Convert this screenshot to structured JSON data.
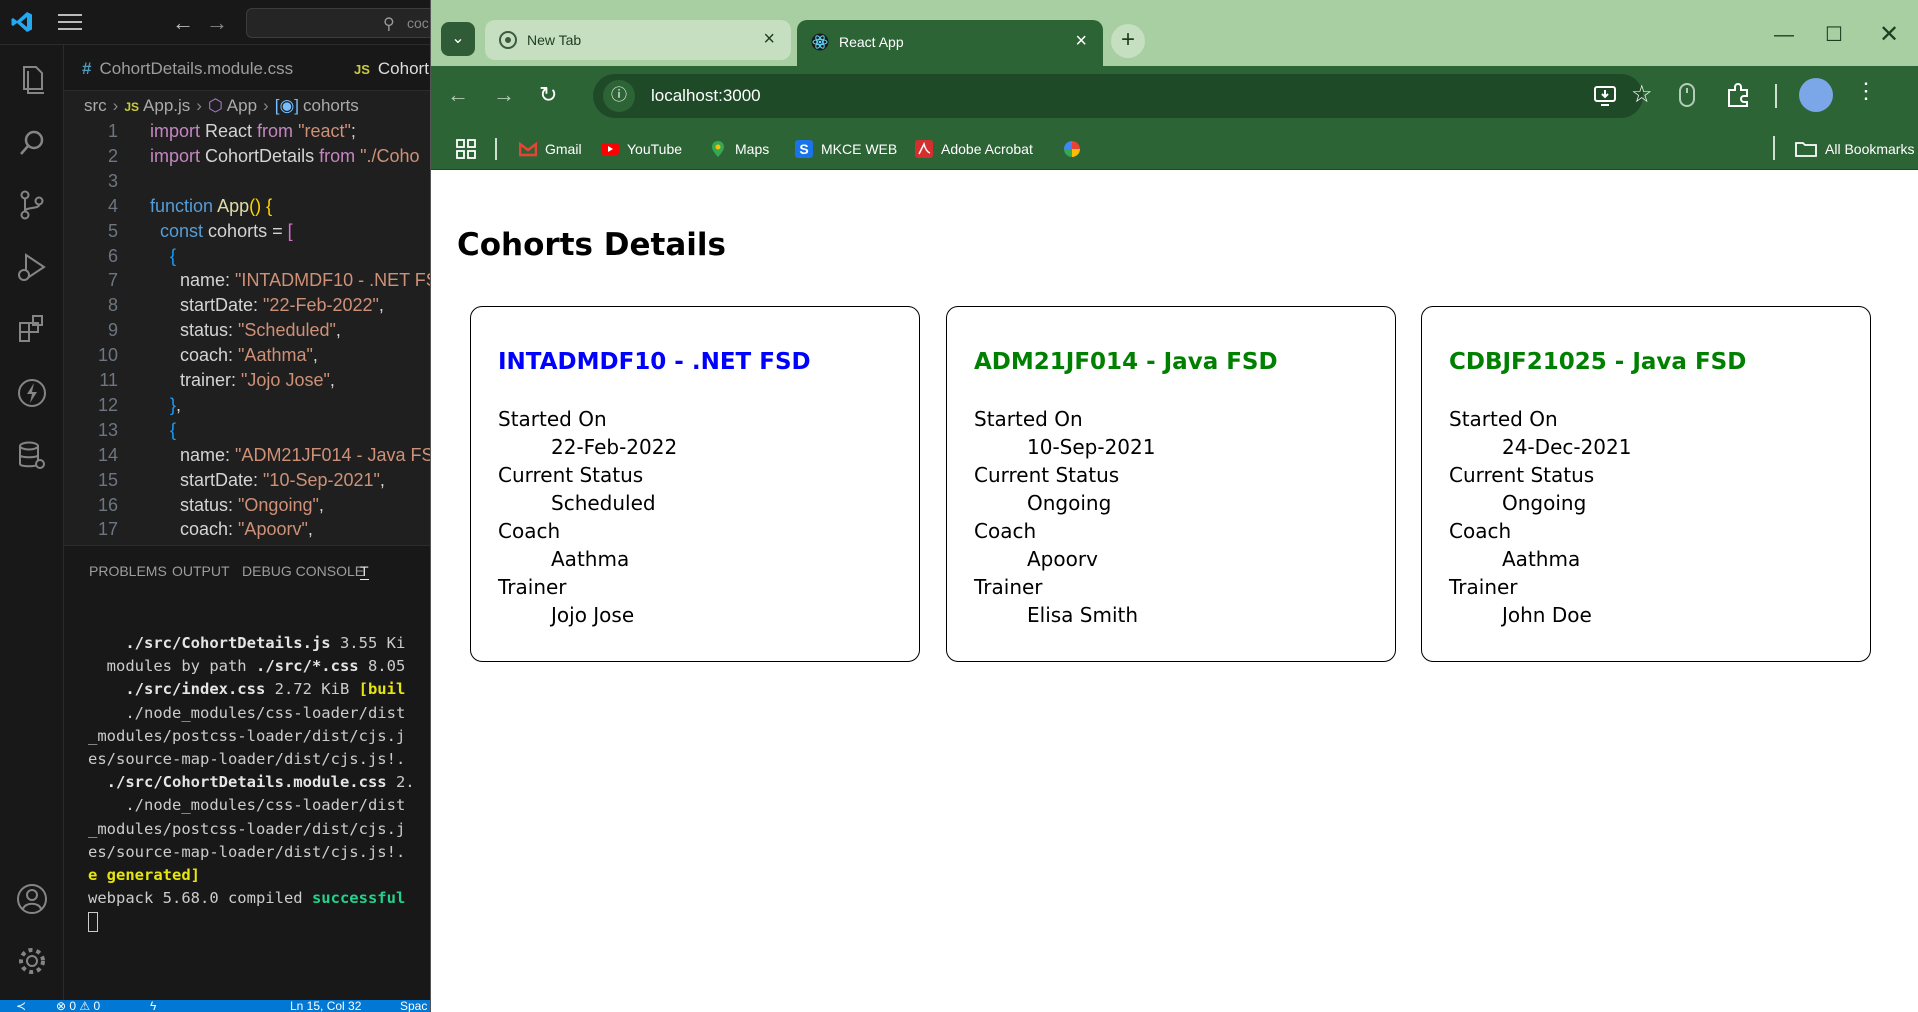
{
  "vscode": {
    "search_placeholder": "coc",
    "tabs": [
      {
        "lang": "#",
        "label": "CohortDetails.module.css"
      },
      {
        "lang": "JS",
        "label": "Cohort"
      }
    ],
    "breadcrumb": [
      "src",
      "App.js",
      "App",
      "cohorts"
    ],
    "code_lines": [
      {
        "n": "1",
        "html": "<span class=\"kw2\">import</span> React <span class=\"kw2\">from</span> <span class=\"str\">\"react\"</span>;"
      },
      {
        "n": "2",
        "html": "<span class=\"kw2\">import</span> CohortDetails <span class=\"kw2\">from</span> <span class=\"str\">\"./Coho</span>"
      },
      {
        "n": "3",
        "html": ""
      },
      {
        "n": "4",
        "html": "<span class=\"kw\">function</span> <span class=\"fn\">App</span><span class=\"br\">()</span> <span class=\"br\">{</span>"
      },
      {
        "n": "5",
        "html": "  <span class=\"kw\">const</span> cohorts = <span class=\"br2\">[</span>"
      },
      {
        "n": "6",
        "html": "    <span class=\"br3\">{</span>"
      },
      {
        "n": "7",
        "html": "      name: <span class=\"str\">\"INTADMDF10 - .NET FS</span>"
      },
      {
        "n": "8",
        "html": "      startDate: <span class=\"str\">\"22-Feb-2022\"</span>,"
      },
      {
        "n": "9",
        "html": "      status: <span class=\"str\">\"Scheduled\"</span>,"
      },
      {
        "n": "10",
        "html": "      coach: <span class=\"str\">\"Aathma\"</span>,"
      },
      {
        "n": "11",
        "html": "      trainer: <span class=\"str\">\"Jojo Jose\"</span>,"
      },
      {
        "n": "12",
        "html": "    <span class=\"br3\">}</span>,"
      },
      {
        "n": "13",
        "html": "    <span class=\"br3\">{</span>"
      },
      {
        "n": "14",
        "html": "      name: <span class=\"str\">\"ADM21JF014 - Java FSD</span>"
      },
      {
        "n": "15",
        "html": "      startDate: <span class=\"str\">\"10-Sep-2021\"</span>,"
      },
      {
        "n": "16",
        "html": "      status: <span class=\"str\">\"Ongoing\"</span>,"
      },
      {
        "n": "17",
        "html": "      coach: <span class=\"str\">\"Apoorv\"</span>,"
      }
    ],
    "panel_tabs": [
      "PROBLEMS",
      "OUTPUT",
      "DEBUG CONSOLE",
      "T"
    ],
    "terminal_lines": [
      "    <span class=\"t-bold\">./src/CohortDetails.js</span> 3.55 Ki",
      "  modules by path <span class=\"t-bold\">./src/*.css</span> 8.05",
      "    <span class=\"t-bold\">./src/index.css</span> 2.72 KiB <span class=\"t-yellow\">[buil</span>",
      "    ./node_modules/css-loader/dist",
      "_modules/postcss-loader/dist/cjs.j",
      "es/source-map-loader/dist/cjs.js!.",
      "  <span class=\"t-bold\">./src/CohortDetails.module.css</span> 2.",
      "    ./node_modules/css-loader/dist",
      "_modules/postcss-loader/dist/cjs.j",
      "es/source-map-loader/dist/cjs.js!.",
      "<span class=\"t-yellow\">e generated]</span>",
      "webpack 5.68.0 compiled <span class=\"t-green\">successful</span>"
    ],
    "status": {
      "problems": "⊗ 0 ⚠ 0",
      "cursor": "Ln 15, Col 32",
      "spaces": "Spac"
    }
  },
  "chrome": {
    "tabs": [
      {
        "label": "New Tab"
      },
      {
        "label": "React App"
      }
    ],
    "url": "localhost:3000",
    "bookmarks": [
      {
        "label": "Gmail",
        "color": "#ea4335"
      },
      {
        "label": "YouTube",
        "color": "#ff0000"
      },
      {
        "label": "Maps",
        "color": "#34a853"
      },
      {
        "label": "MKCE WEB",
        "color": "#1a73e8"
      },
      {
        "label": "Adobe Acrobat",
        "color": "#d32f2f"
      },
      {
        "label": "",
        "color": "#fbbc04"
      }
    ],
    "all_bookmarks": "All Bookmarks"
  },
  "page": {
    "title": "Cohorts Details",
    "labels": {
      "started_on": "Started On",
      "current_status": "Current Status",
      "coach": "Coach",
      "trainer": "Trainer"
    },
    "cohorts": [
      {
        "name": "INTADMDF10 - .NET FSD",
        "start_date": "22-Feb-2022",
        "status": "Scheduled",
        "coach": "Aathma",
        "trainer": "Jojo Jose",
        "title_color": "#0000ff"
      },
      {
        "name": "ADM21JF014 - Java FSD",
        "start_date": "10-Sep-2021",
        "status": "Ongoing",
        "coach": "Apoorv",
        "trainer": "Elisa Smith",
        "title_color": "#008000"
      },
      {
        "name": "CDBJF21025 - Java FSD",
        "start_date": "24-Dec-2021",
        "status": "Ongoing",
        "coach": "Aathma",
        "trainer": "John Doe",
        "title_color": "#008000"
      }
    ]
  }
}
